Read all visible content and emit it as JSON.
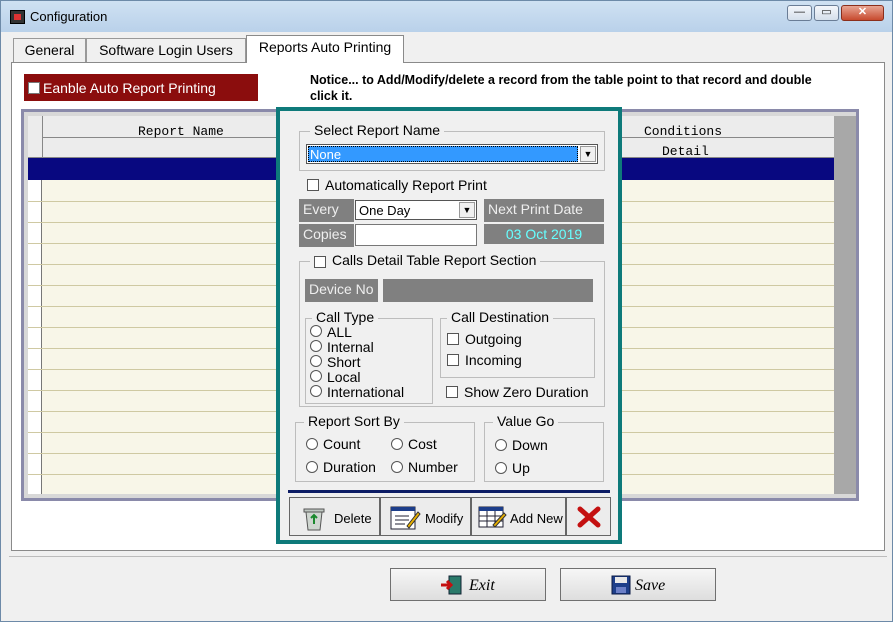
{
  "window": {
    "title": "Configuration",
    "controls": {
      "minimize": "—",
      "maximize": "▭",
      "close": "✕"
    }
  },
  "tabs": [
    {
      "label": "General"
    },
    {
      "label": "Software Login Users"
    },
    {
      "label": "Reports Auto Printing"
    }
  ],
  "enable_auto_print": {
    "label": "Eanble Auto Report Printing",
    "checked": false
  },
  "notice": "Notice... to Add/Modify/delete a record from the table point to that record and double click it.",
  "grid": {
    "columns": {
      "report_name": "Report Name",
      "conditions": "Conditions",
      "detail": "Detail"
    }
  },
  "dialog": {
    "select_report": {
      "title": "Select Report Name",
      "value": "None"
    },
    "auto_print": {
      "label": "Automatically Report Print",
      "checked": false
    },
    "every": {
      "label": "Every",
      "value": "One Day"
    },
    "next_print": {
      "label": "Next Print Date",
      "value": "03 Oct 2019"
    },
    "copies": {
      "label": "Copies",
      "value": ""
    },
    "calls_detail": {
      "title": "Calls Detail Table Report  Section",
      "checked": false,
      "device_no": {
        "label": "Device No",
        "value": ""
      },
      "call_type": {
        "title": "Call Type",
        "options": [
          "ALL",
          "Internal",
          "Short",
          "Local",
          "International"
        ]
      },
      "call_destination": {
        "title": "Call Destination",
        "options": [
          "Outgoing",
          "Incoming"
        ]
      },
      "show_zero": "Show Zero Duration"
    },
    "sort_by": {
      "title": "Report Sort By",
      "options": [
        "Count",
        "Cost",
        "Duration",
        "Number"
      ]
    },
    "value_go": {
      "title": "Value Go",
      "options": [
        "Down",
        "Up"
      ]
    },
    "buttons": {
      "delete": "Delete",
      "modify": "Modify",
      "add_new": "Add New"
    }
  },
  "footer": {
    "exit": "Exit",
    "save": "Save"
  },
  "colors": {
    "accent_teal": "#0e7a7a",
    "selection_navy": "#080880",
    "enable_red": "#8b0d0d",
    "date_cyan": "#66ffff"
  }
}
